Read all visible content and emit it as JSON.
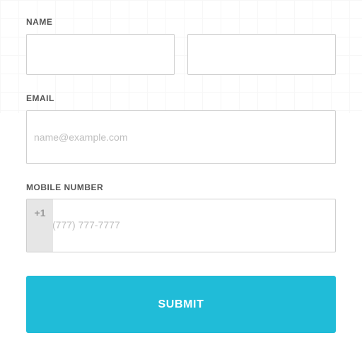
{
  "form": {
    "name_label": "NAME",
    "email_label": "EMAIL",
    "email_placeholder": "name@example.com",
    "mobile_label": "MOBILE NUMBER",
    "phone_prefix": "+1",
    "phone_placeholder": "(777) 777-7777",
    "submit_label": "SUBMIT"
  },
  "colors": {
    "submit_bg": "#20bcd8",
    "prefix_bg": "#e6e6e6",
    "border": "#cfcfcf"
  }
}
